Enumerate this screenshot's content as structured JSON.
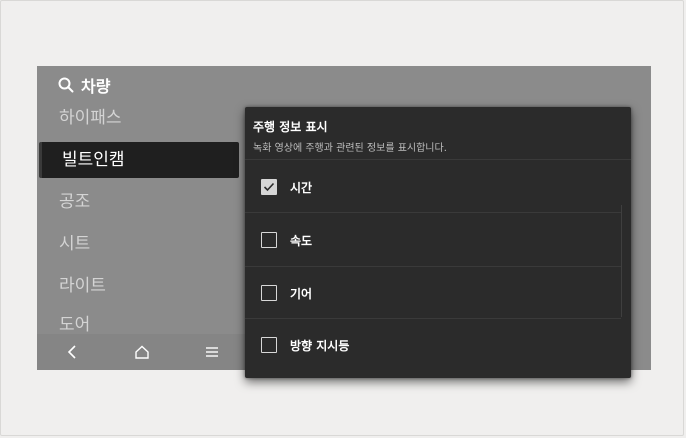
{
  "header": {
    "search_title": "차량"
  },
  "sidebar": {
    "items": [
      {
        "label": "하이패스",
        "active": false
      },
      {
        "label": "빌트인캠",
        "active": true
      },
      {
        "label": "공조",
        "active": false
      },
      {
        "label": "시트",
        "active": false
      },
      {
        "label": "라이트",
        "active": false
      },
      {
        "label": "도어",
        "active": false
      }
    ]
  },
  "bottom_nav": {
    "icons": [
      "back-icon",
      "home-icon",
      "menu-icon"
    ]
  },
  "panel": {
    "title": "주행 정보 표시",
    "description": "녹화 영상에 주행과 관련된 정보를 표시합니다.",
    "options": [
      {
        "label": "시간",
        "checked": true
      },
      {
        "label": "속도",
        "checked": false
      },
      {
        "label": "기어",
        "checked": false
      },
      {
        "label": "방향 지시등",
        "checked": false
      }
    ]
  },
  "colors": {
    "screen_bg": "#8b8b8b",
    "panel_bg": "#2b2b2b",
    "active_item_bg": "#1f1f1f",
    "page_bg": "#f0efee"
  }
}
